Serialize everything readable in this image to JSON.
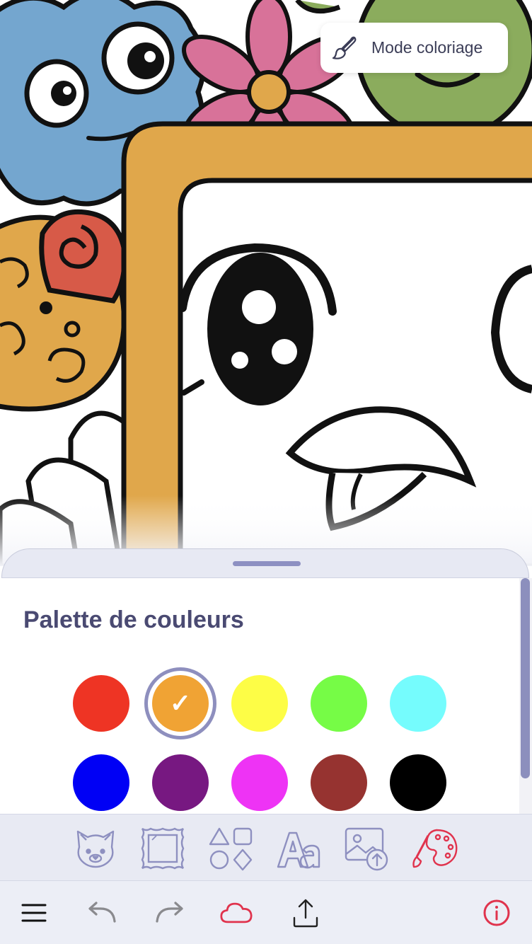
{
  "mode_button": {
    "label": "Mode coloriage",
    "icon": "paintbrush-icon"
  },
  "palette": {
    "title": "Palette de couleurs",
    "selected_index": 1,
    "check_mark": "✓",
    "colors": [
      "#ee3424",
      "#f0a334",
      "#fdfd46",
      "#76fc46",
      "#75fcfd",
      "#0000f5",
      "#771881",
      "#ee33f5",
      "#963330",
      "#000000"
    ]
  },
  "toolbar": {
    "items": [
      "animal-face-icon",
      "frame-icon",
      "shapes-icon",
      "text-icon",
      "image-upload-icon",
      "palette-icon"
    ],
    "active_item": "palette-icon"
  },
  "bottom_bar": {
    "items": [
      "menu-icon",
      "undo-icon",
      "redo-icon",
      "cloud-icon",
      "share-icon",
      "info-icon"
    ]
  },
  "colors": {
    "accent": "#e0334d",
    "muted_icon": "#8e90c0",
    "title": "#4a4a72"
  }
}
